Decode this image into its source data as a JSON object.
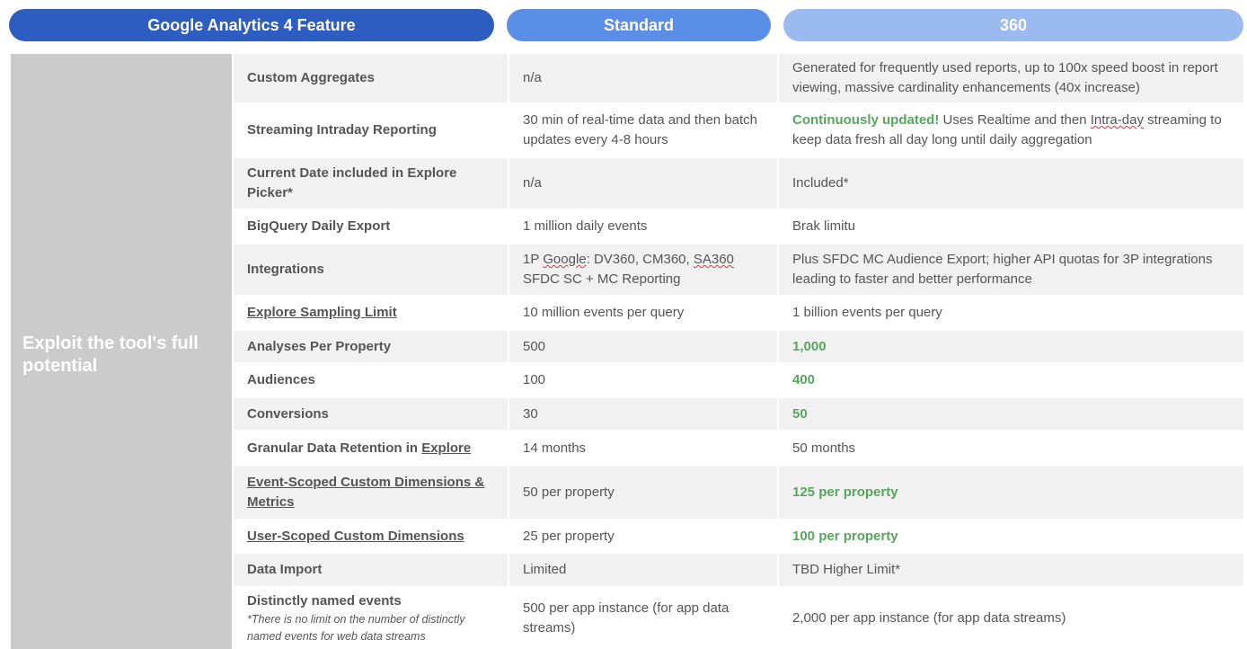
{
  "header": {
    "feature": "Google Analytics 4 Feature",
    "standard": "Standard",
    "premium": "360"
  },
  "colors": {
    "feature_header": "#2d5dc0",
    "standard_header": "#5b8ee6",
    "premium_header": "#9bbaf0",
    "sidebar": "#cbcbcb",
    "highlight_green": "#58a55c"
  },
  "sidebar": {
    "label": "Exploit the tool's full potential"
  },
  "rows": [
    {
      "feature": "Custom Aggregates",
      "standard": "n/a",
      "premium": "Generated for frequently used reports, up to 100x speed boost in report viewing, massive cardinality enhancements (40x increase)"
    },
    {
      "feature": "Streaming Intraday Reporting",
      "standard": "30 min of real-time data and then batch updates every 4-8 hours",
      "premium_highlight": "Continuously updated!",
      "premium_pre": " Uses Realtime and then ",
      "premium_squiggle": "Intra-day",
      "premium_post": " streaming to keep data fresh all day long until daily aggregation"
    },
    {
      "feature": "Current Date included in Explore Picker*",
      "standard": "n/a",
      "premium": "Included*"
    },
    {
      "feature": "BigQuery Daily Export",
      "standard": "1 million daily events",
      "premium": "Brak limitu"
    },
    {
      "feature": "Integrations",
      "standard_line1_a": "1P ",
      "standard_line1_sq1": "Google",
      "standard_line1_b": ": DV360, CM360, ",
      "standard_line1_sq2": "SA360",
      "standard_line2": "SFDC SC + MC Reporting",
      "premium": "Plus SFDC MC Audience Export; higher API quotas for 3P integrations leading to faster and better performance"
    },
    {
      "feature": "Explore Sampling Limit",
      "standard": "10 million events per query",
      "premium": "1 billion events per query"
    },
    {
      "feature": "Analyses Per Property",
      "standard": "500",
      "premium": "1,000"
    },
    {
      "feature": "Audiences",
      "standard": "100",
      "premium": "400"
    },
    {
      "feature": "Conversions",
      "standard": "30",
      "premium": "50"
    },
    {
      "feature_pre": "Granular Data Retention in ",
      "feature_link": "Explore",
      "standard": "14 months",
      "premium": "50 months"
    },
    {
      "feature": "Event-Scoped Custom Dimensions & Metrics",
      "standard": "50 per property",
      "premium": "125 per property"
    },
    {
      "feature": "User-Scoped Custom Dimensions",
      "standard": "25 per property",
      "premium": "100 per property"
    },
    {
      "feature": "Data Import",
      "standard": "Limited",
      "premium": "TBD Higher Limit*"
    },
    {
      "feature": "Distinctly named events",
      "feature_note": "*There is no limit on the number of distinctly named events for web data streams",
      "standard": "500 per app instance (for app data streams)",
      "premium": "2,000 per app instance (for app data streams)"
    }
  ]
}
